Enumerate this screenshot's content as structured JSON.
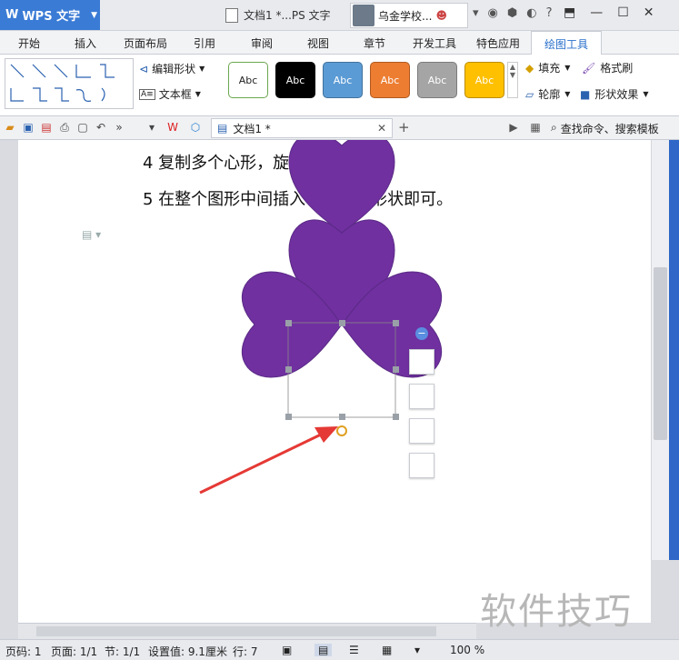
{
  "app": {
    "name": "WPS 文字",
    "document_title": "文档1 *...PS 文字",
    "user_name": "乌金学校..."
  },
  "menu": {
    "items": [
      "开始",
      "插入",
      "页面布局",
      "引用",
      "审阅",
      "视图",
      "章节",
      "开发工具",
      "特色应用",
      "绘图工具"
    ],
    "active": "绘图工具"
  },
  "ribbon": {
    "edit_shape_label": "编辑形状",
    "textbox_label": "文本框",
    "shape_styles": [
      {
        "label": "Abc",
        "bg": "#ffffff",
        "fg": "#222222",
        "border": "#6aa84f"
      },
      {
        "label": "Abc",
        "bg": "#000000",
        "fg": "#ffffff",
        "border": "#000000"
      },
      {
        "label": "Abc",
        "bg": "#5b9bd5",
        "fg": "#ffffff",
        "border": "#41719c"
      },
      {
        "label": "Abc",
        "bg": "#ed7d31",
        "fg": "#ffffff",
        "border": "#ae5a21"
      },
      {
        "label": "Abc",
        "bg": "#a5a5a5",
        "fg": "#ffffff",
        "border": "#7b7b7b"
      },
      {
        "label": "Abc",
        "bg": "#ffc000",
        "fg": "#ffffff",
        "border": "#bc8c00"
      }
    ],
    "fill_label": "填充",
    "format_brush_label": "格式刷",
    "outline_label": "轮廓",
    "shape_effect_label": "形状效果"
  },
  "tabbar": {
    "doc_tab": "文档1 *",
    "search_cmd": "查找命令、搜索模板"
  },
  "document": {
    "line4": "4 复制多个心形，旋转调整角度。",
    "line5": "5 在整个图形中间插入一个太阳形状即可。",
    "shape_fill": "#7030a0",
    "arrow_color": "#e53935"
  },
  "watermark": "软件技巧",
  "status": {
    "page_num": "页码: 1",
    "pages": "页面: 1/1",
    "section": "节: 1/1",
    "setting": "设置值: 9.1厘米",
    "row": "行: 7",
    "zoom": "100 %"
  }
}
